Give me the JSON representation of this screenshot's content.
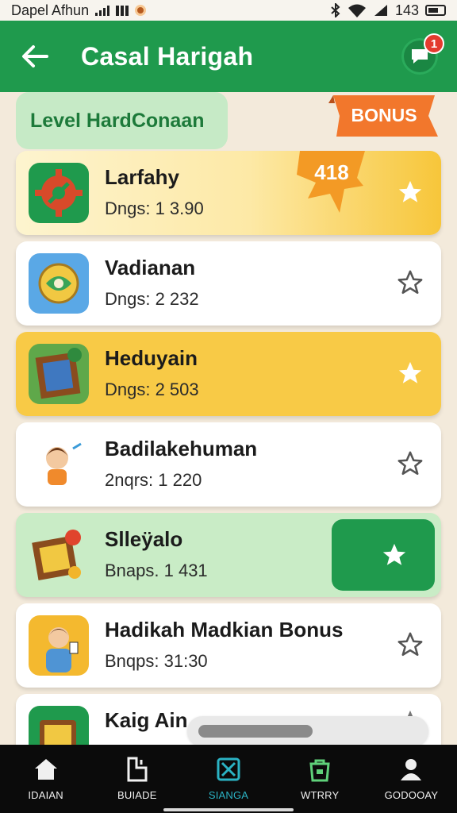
{
  "status_bar": {
    "carrier": "Dapel Afhun",
    "time": "143"
  },
  "header": {
    "title": "Casal Harigah",
    "notification_count": "1"
  },
  "level_label": "Level HardConaan",
  "bonus_label": "BONUS",
  "score_badge": "418",
  "items": [
    {
      "title": "Larfahy",
      "subtitle": "Dngs: 1 3.90",
      "style": "orange",
      "favorited": true
    },
    {
      "title": "Vadianan",
      "subtitle": "Dngs: 2 232",
      "style": "white",
      "favorited": false
    },
    {
      "title": "Heduyain",
      "subtitle": "Dngs: 2 503",
      "style": "yellow",
      "favorited": true
    },
    {
      "title": "Badilakehuman",
      "subtitle": "2nqrs: 1 220",
      "style": "white",
      "favorited": false
    },
    {
      "title": "Slleÿalo",
      "subtitle": "Bnaps. 1 431",
      "style": "green",
      "favorited": true
    },
    {
      "title": "Hadikah Madkian Bonus",
      "subtitle": "Bnqps: 31:30",
      "style": "white",
      "favorited": false
    },
    {
      "title": "Kaig Ain",
      "subtitle": "",
      "style": "white",
      "favorited": false
    }
  ],
  "bottom_nav": [
    {
      "label": "IDAIAN",
      "icon": "home-icon"
    },
    {
      "label": "BUIADE",
      "icon": "board-icon"
    },
    {
      "label": "SIANGA",
      "icon": "puzzle-icon",
      "active": true
    },
    {
      "label": "WTRRY",
      "icon": "bag-icon"
    },
    {
      "label": "GODOOAY",
      "icon": "profile-icon"
    }
  ],
  "colors": {
    "primary": "#1f9a4d",
    "accent_orange": "#f2772c",
    "yellow": "#f8ca46",
    "active_nav": "#2bb3c4"
  }
}
